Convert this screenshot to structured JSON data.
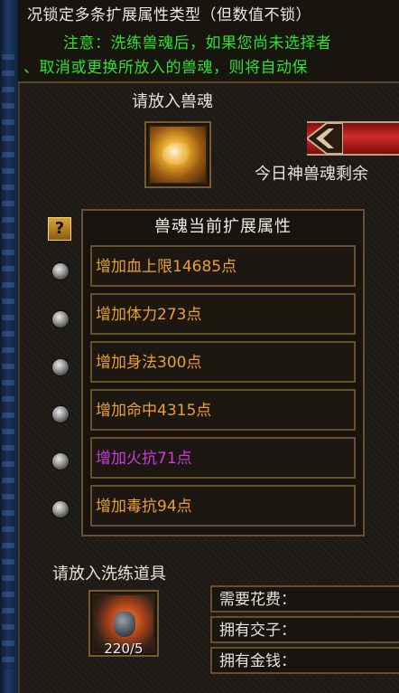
{
  "notice": {
    "line1": "况锁定多条扩展属性类型（但数值不锁）",
    "line2": "注意：洗练兽魂后，如果您尚未选择者",
    "line3": "、取消或更换所放入的兽魂，则将自动保"
  },
  "soul_slot": {
    "label": "请放入兽魂",
    "icon": "golden-beast-soul-icon"
  },
  "daily": {
    "text": "今日神兽魂剩余"
  },
  "attributes": {
    "header": "兽魂当前扩展属性",
    "help_icon": "?",
    "items": [
      {
        "text": "增加血上限14685点",
        "color": "#e8a030"
      },
      {
        "text": "增加体力273点",
        "color": "#e8a030"
      },
      {
        "text": "增加身法300点",
        "color": "#e8a030"
      },
      {
        "text": "增加命中4315点",
        "color": "#e8a030"
      },
      {
        "text": "增加火抗71点",
        "color": "#c83cdc"
      },
      {
        "text": "增加毒抗94点",
        "color": "#e8a030"
      }
    ]
  },
  "refine_item": {
    "label": "请放入洗练道具",
    "count": "220/5",
    "icon": "refine-item-icon"
  },
  "costs": {
    "fee": "需要花费：",
    "coin": "拥有交子：",
    "money": "拥有金钱："
  }
}
